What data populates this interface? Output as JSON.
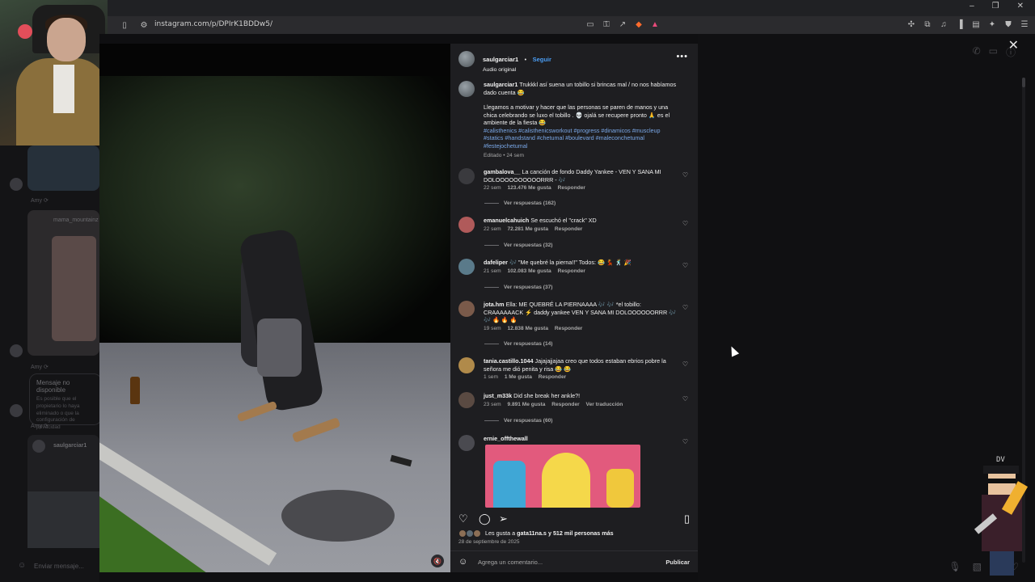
{
  "browser": {
    "url": "instagram.com/p/DPIrK1BDDw5/",
    "window_controls": [
      "–",
      "❐",
      "✕"
    ]
  },
  "left_panel": {
    "time1": "Amy ⟳",
    "user_label": "mama_mountainz",
    "time2": "Amy ⟳",
    "msg_title": "Mensaje no disponible",
    "msg_text": "Es posible que el propietario lo haya eliminado o que la configuración de privacidad",
    "time3": "Amy ⟳",
    "sender": "saulgarciar1",
    "input_placeholder": "Enviar mensaje..."
  },
  "post": {
    "author": "saulgarciar1",
    "follow": "Seguir",
    "dot": "•",
    "audio": "Audio original",
    "more": "•••",
    "caption": {
      "user": "saulgarciar1",
      "text1": "Trukkkl así suena un tobillo si brincas mal / no nos habíamos dado cuenta 😂",
      "text2": "Llegamos a motivar y hacer que las personas se paren de manos y una chica celebrando se luxo el tobillo . 💀 ojalá se recupere pronto 🙏 es el ambiente de la fiesta 😂",
      "hashtags": "#calisthenics #calisthenicsworkout #progress #dinamicos #muscleup #statics #handstand #chetumal #boulevard #maleconchetumal #festejochetumal",
      "edited": "Editado • 24 sem"
    },
    "comments": [
      {
        "user": "gambalova__",
        "text": "La canción de fondo Daddy Yankee - VEN Y SANA MI DOLOOOOOOOOOORRR - 🎶",
        "time": "22 sem",
        "likes": "123.476 Me gusta",
        "reply": "Responder",
        "view_replies": "Ver respuestas (162)"
      },
      {
        "user": "emanuelcahuich",
        "text": "Se escuchó el \"crack\" XD",
        "time": "22 sem",
        "likes": "72.281 Me gusta",
        "reply": "Responder",
        "view_replies": "Ver respuestas (32)"
      },
      {
        "user": "dafeliper",
        "text": "🎶 \"Me quebré la pierna!!\" Todos: 😂 💃 🕺 🎉",
        "time": "21 sem",
        "likes": "102.083 Me gusta",
        "reply": "Responder",
        "view_replies": "Ver respuestas (37)"
      },
      {
        "user": "jota.hm",
        "text": "Ella: ME QUEBRÉ LA PIERNAAAA 🎶 🎶 *el tobillo: CRAAAAAACK ⚡ daddy yankee VEN Y SANA MI DOLOOOOOORRR 🎶 🎶 🔥 🔥 🔥",
        "time": "19 sem",
        "likes": "12.838 Me gusta",
        "reply": "Responder",
        "view_replies": "Ver respuestas (14)"
      },
      {
        "user": "tania.castillo.1044",
        "text": "Jajajajjajaa creo que todos estaban ebrios pobre la señora me dió penita y risa 😂 😂",
        "time": "1 sem",
        "likes": "1 Me gusta",
        "reply": "Responder",
        "view_replies": ""
      },
      {
        "user": "just_m33k",
        "text": "Did she break her ankle?!",
        "time": "23 sem",
        "likes": "9.891 Me gusta",
        "reply": "Responder",
        "translate": "Ver traducción",
        "view_replies": "Ver respuestas (60)"
      },
      {
        "user": "ernie_offthewall",
        "text": "",
        "time": "",
        "likes": "",
        "reply": "",
        "view_replies": ""
      }
    ],
    "likes_summary_prefix": "Les gusta a",
    "likes_summary_user": "gata11na.s",
    "likes_summary_mid": "y",
    "likes_summary_count": "512 mil personas más",
    "date": "28 de septiembre de 2025",
    "comment_placeholder": "Agrega un comentario...",
    "publish": "Publicar",
    "close": "✕"
  },
  "overlay_badge": "DV"
}
